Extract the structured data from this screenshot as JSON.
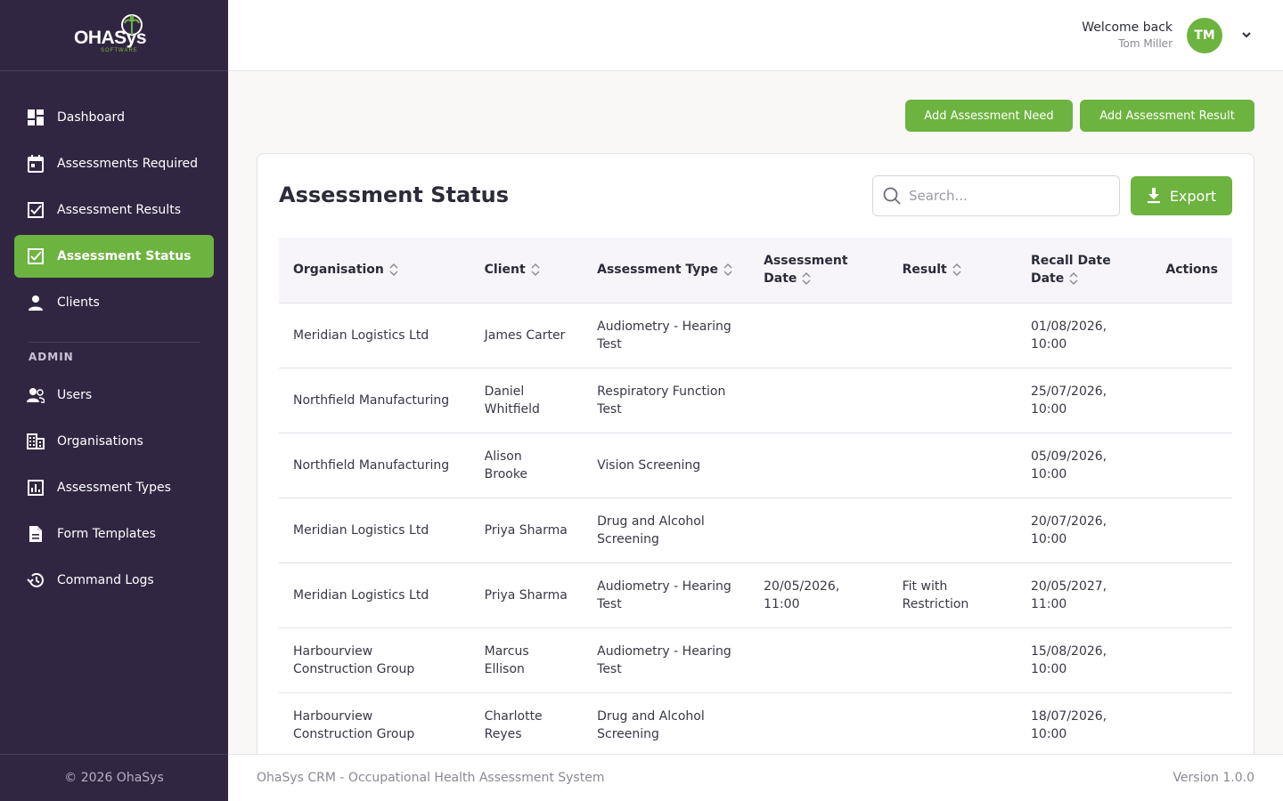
{
  "brand": {
    "name": "OHASys",
    "sub": "SOFTWARE",
    "accent": "#6db33f",
    "sidebar_bg": "#312642"
  },
  "sidebar": {
    "items": [
      {
        "label": "Dashboard",
        "icon": "dashboard-icon"
      },
      {
        "label": "Assessments Required",
        "icon": "calendar-icon"
      },
      {
        "label": "Assessment Results",
        "icon": "checkbox-icon"
      },
      {
        "label": "Assessment Status",
        "icon": "checkbox-icon",
        "active": true
      },
      {
        "label": "Clients",
        "icon": "person-icon"
      }
    ],
    "admin_label": "ADMIN",
    "admin_items": [
      {
        "label": "Users",
        "icon": "users-icon"
      },
      {
        "label": "Organisations",
        "icon": "building-icon"
      },
      {
        "label": "Assessment Types",
        "icon": "bar-chart-icon"
      },
      {
        "label": "Form Templates",
        "icon": "document-icon"
      },
      {
        "label": "Command Logs",
        "icon": "history-icon"
      }
    ],
    "footer": "© 2026 OhaSys"
  },
  "header": {
    "welcome": "Welcome back",
    "user_name": "Tom Miller",
    "avatar_initials": "TM"
  },
  "actions": {
    "add_need": "Add Assessment Need",
    "add_result": "Add Assessment Result"
  },
  "card": {
    "title": "Assessment Status",
    "search_placeholder": "Search...",
    "export_label": "Export"
  },
  "table": {
    "columns": [
      "Organisation",
      "Client",
      "Assessment Type",
      "Assessment Date",
      "Result",
      "Recall Date Date",
      "Actions"
    ],
    "rows": [
      [
        "Meridian Logistics Ltd",
        "James Carter",
        "Audiometry - Hearing Test",
        "",
        "",
        "01/08/2026, 10:00",
        ""
      ],
      [
        "Northfield Manufacturing",
        "Daniel Whitfield",
        "Respiratory Function Test",
        "",
        "",
        "25/07/2026, 10:00",
        ""
      ],
      [
        "Northfield Manufacturing",
        "Alison Brooke",
        "Vision Screening",
        "",
        "",
        "05/09/2026, 10:00",
        ""
      ],
      [
        "Meridian Logistics Ltd",
        "Priya Sharma",
        "Drug and Alcohol Screening",
        "",
        "",
        "20/07/2026, 10:00",
        ""
      ],
      [
        "Meridian Logistics Ltd",
        "Priya Sharma",
        "Audiometry - Hearing Test",
        "20/05/2026, 11:00",
        "Fit with Restriction",
        "20/05/2027, 11:00",
        ""
      ],
      [
        "Harbourview Construction Group",
        "Marcus Ellison",
        "Audiometry - Hearing Test",
        "",
        "",
        "15/08/2026, 10:00",
        ""
      ],
      [
        "Harbourview Construction Group",
        "Charlotte Reyes",
        "Drug and Alcohol Screening",
        "",
        "",
        "18/07/2026, 10:00",
        ""
      ]
    ]
  },
  "footer": {
    "left": "OhaSys CRM - Occupational Health Assessment System",
    "right": "Version 1.0.0"
  }
}
